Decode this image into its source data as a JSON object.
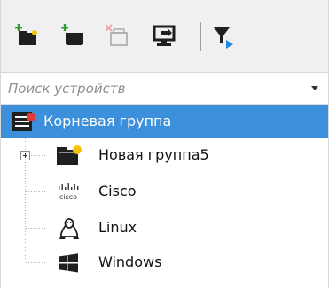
{
  "toolbar": {
    "buttons": [
      {
        "icon": "add-group-icon"
      },
      {
        "icon": "add-device-icon"
      },
      {
        "icon": "delete-icon"
      },
      {
        "icon": "connect-icon"
      },
      {
        "icon": "filter-icon"
      }
    ]
  },
  "search": {
    "placeholder": "Поиск устройств",
    "value": ""
  },
  "tree": {
    "root": {
      "label": "Корневая группа",
      "icon": "server-group-icon",
      "selected": true
    },
    "children": [
      {
        "label": "Новая группа5",
        "icon": "folder-icon",
        "collapsed": true
      },
      {
        "label": "Cisco",
        "icon": "cisco-icon"
      },
      {
        "label": "Linux",
        "icon": "linux-icon"
      },
      {
        "label": "Windows",
        "icon": "windows-icon"
      }
    ]
  },
  "colors": {
    "selection": "#3c8fda",
    "accent_green": "#2e9b2e",
    "status_red": "#e53935",
    "status_yellow": "#f4c20d"
  }
}
